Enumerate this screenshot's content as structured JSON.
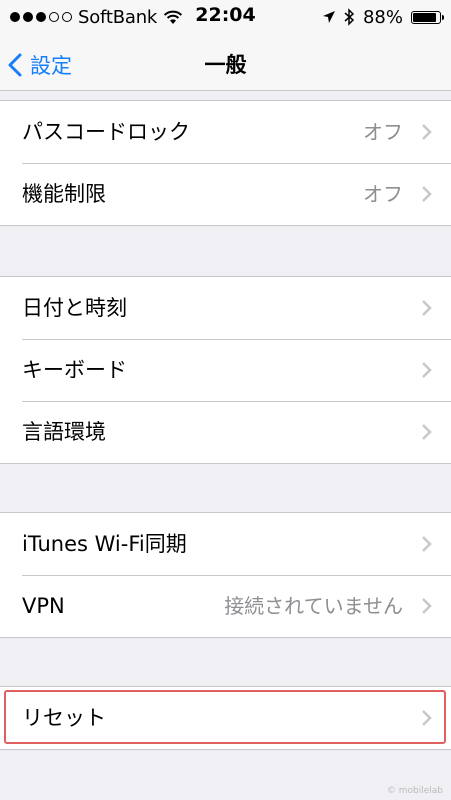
{
  "status_bar": {
    "carrier": "SoftBank",
    "signal_filled": 3,
    "signal_total": 5,
    "time": "22:04",
    "battery_percent_label": "88%",
    "battery_level": 0.88,
    "icons": [
      "wifi-icon",
      "location-arrow-icon",
      "bluetooth-icon",
      "battery-icon"
    ]
  },
  "nav": {
    "back_label": "設定",
    "title": "一般"
  },
  "groups": [
    {
      "rows": [
        {
          "label": "パスコードロック",
          "value": "オフ"
        },
        {
          "label": "機能制限",
          "value": "オフ"
        }
      ]
    },
    {
      "rows": [
        {
          "label": "日付と時刻",
          "value": ""
        },
        {
          "label": "キーボード",
          "value": ""
        },
        {
          "label": "言語環境",
          "value": ""
        }
      ]
    },
    {
      "rows": [
        {
          "label": "iTunes Wi-Fi同期",
          "value": ""
        },
        {
          "label": "VPN",
          "value": "接続されていません"
        }
      ]
    },
    {
      "rows": [
        {
          "label": "リセット",
          "value": ""
        }
      ]
    }
  ],
  "watermark": "© mobilelab",
  "colors": {
    "accent": "#157efb",
    "highlight": "#e06060",
    "background": "#efeff4"
  }
}
